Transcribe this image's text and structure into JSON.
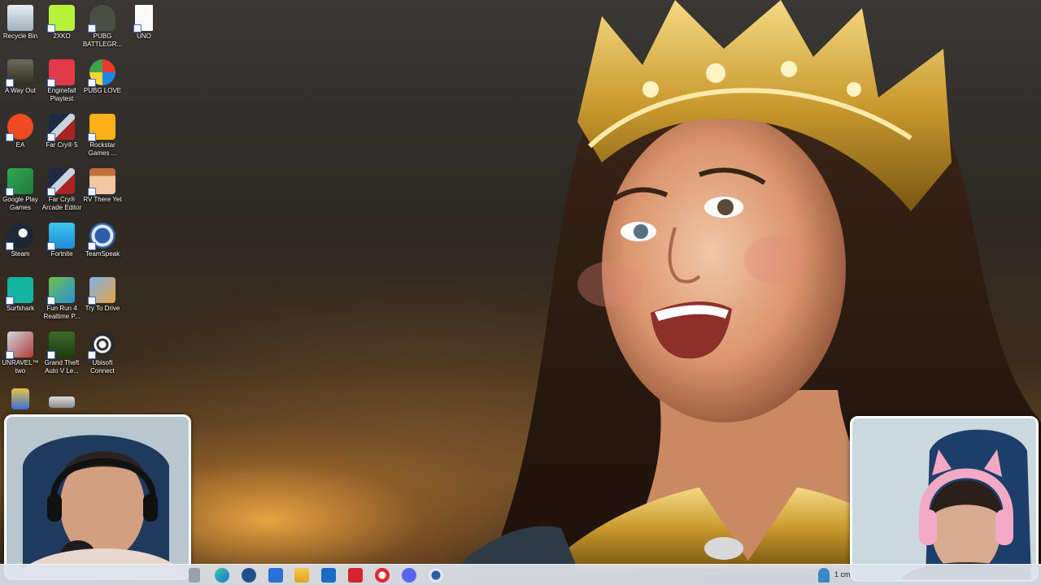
{
  "desktop": {
    "icons": [
      {
        "label": "Recycle Bin",
        "icon": "recycle-bin-icon"
      },
      {
        "label": "2XKO",
        "icon": "2xko-icon"
      },
      {
        "label": "PUBG BATTLEGR...",
        "icon": "pubg-icon"
      },
      {
        "label": "UNO",
        "icon": "file-icon"
      },
      {
        "label": "A Way Out",
        "icon": "a-way-out-icon"
      },
      {
        "label": "Enginefall Playtest",
        "icon": "enginefall-icon"
      },
      {
        "label": "PUBG LOVE",
        "icon": "pubg-love-icon"
      },
      {
        "label": "EA",
        "icon": "ea-icon"
      },
      {
        "label": "Far Cry® 5",
        "icon": "far-cry-5-icon"
      },
      {
        "label": "Rockstar Games ...",
        "icon": "rockstar-icon"
      },
      {
        "label": "Google Play Games",
        "icon": "google-play-games-icon"
      },
      {
        "label": "Far Cry® Arcade Editor",
        "icon": "far-cry-arcade-icon"
      },
      {
        "label": "RV There Yet",
        "icon": "rv-there-yet-icon"
      },
      {
        "label": "Steam",
        "icon": "steam-icon"
      },
      {
        "label": "Fortnite",
        "icon": "fortnite-icon"
      },
      {
        "label": "TeamSpeak",
        "icon": "teamspeak-icon"
      },
      {
        "label": "Surfshark",
        "icon": "surfshark-icon"
      },
      {
        "label": "Fun Run 4 Realtime P...",
        "icon": "fun-run-icon"
      },
      {
        "label": "Try To Drive",
        "icon": "try-to-drive-icon"
      },
      {
        "label": "UNRAVEL™ two",
        "icon": "unravel-icon"
      },
      {
        "label": "Grand Theft Auto V Le...",
        "icon": "gta-v-icon"
      },
      {
        "label": "Ubisoft Connect",
        "icon": "ubisoft-icon"
      }
    ]
  },
  "colors": {
    "taskbar": "#dee4eb",
    "accent_gold": "#c99a2e"
  },
  "taskbar": {
    "apps": [
      "task-view-icon",
      "edge-icon",
      "steam-icon",
      "calculator-icon",
      "file-explorer-icon",
      "outlook-icon",
      "tv-app-icon",
      "opera-icon",
      "discord-icon",
      "teamspeak-icon"
    ],
    "tray_text": "1 cm"
  }
}
